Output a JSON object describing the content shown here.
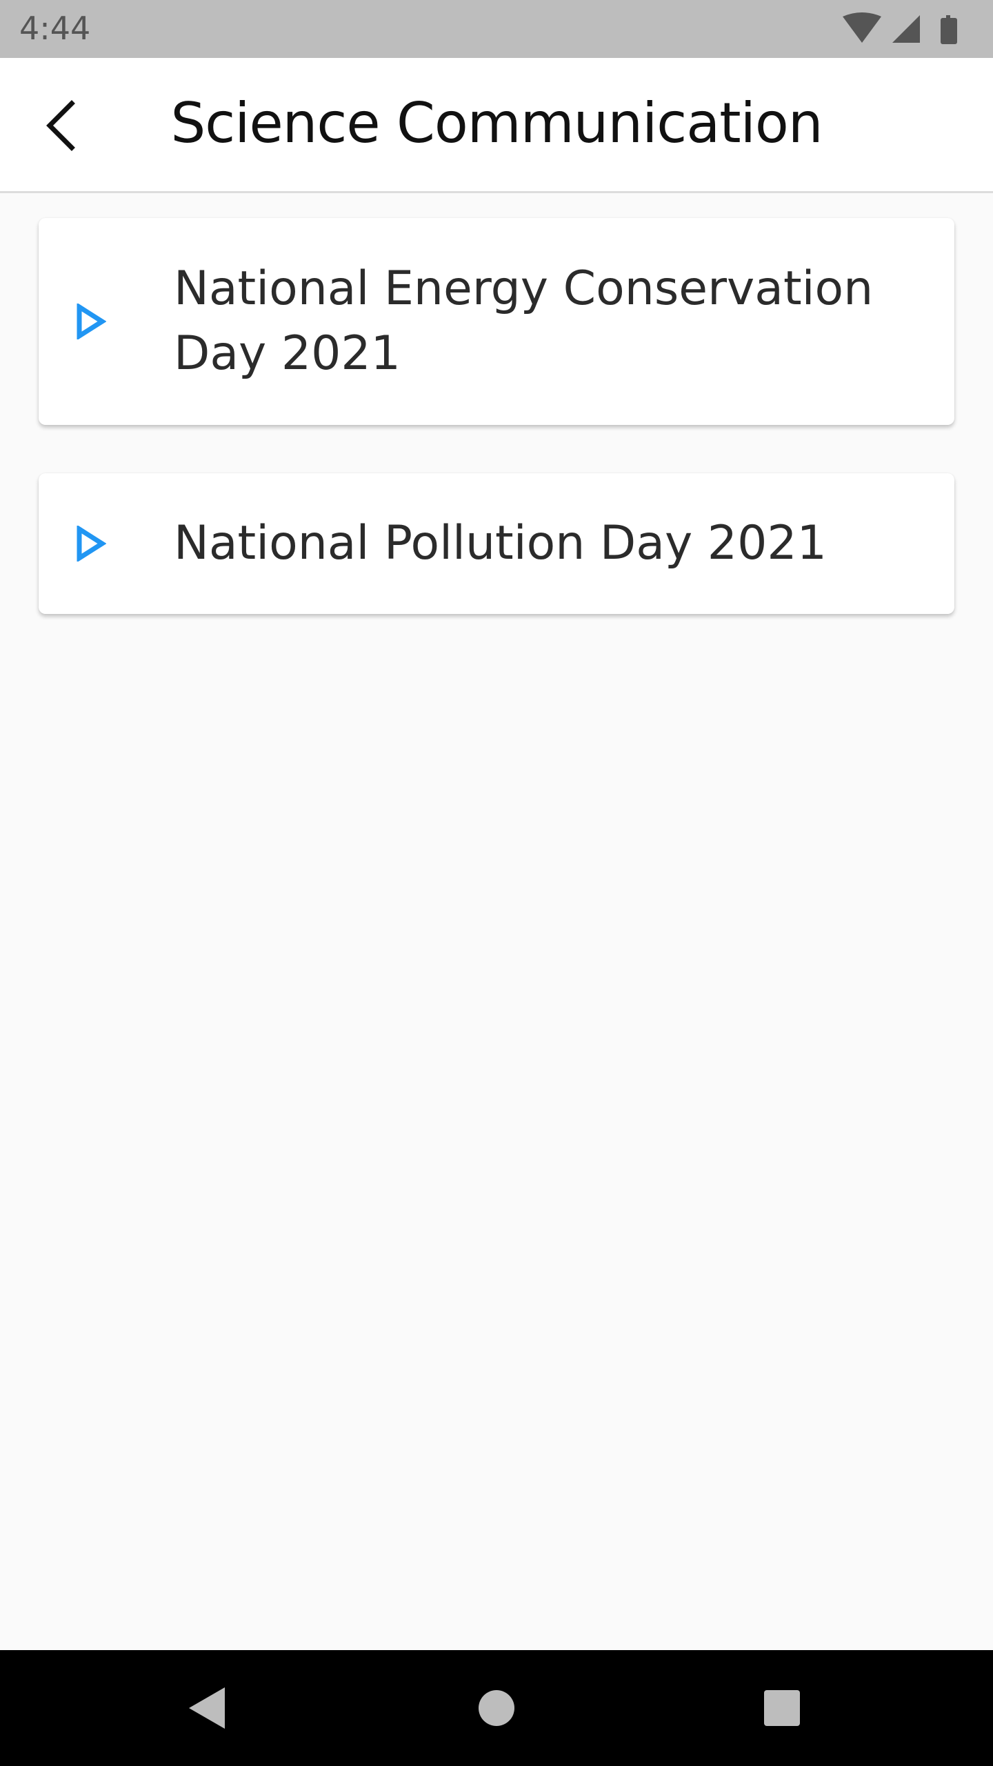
{
  "status_bar": {
    "time": "4:44",
    "icons": [
      "wifi-icon",
      "cellular-signal-icon",
      "battery-icon"
    ]
  },
  "app_bar": {
    "back_icon": "chevron-left-icon",
    "title": "Science Communication"
  },
  "list": {
    "items": [
      {
        "label": "National Energy Conservation Day 2021",
        "icon": "play-triangle-icon"
      },
      {
        "label": "National Pollution Day 2021",
        "icon": "play-triangle-icon"
      }
    ]
  },
  "nav_bar": {
    "buttons": [
      "back-triangle-icon",
      "home-circle-icon",
      "recents-square-icon"
    ]
  },
  "colors": {
    "accent": "#2196f3",
    "status_bar": "#bdbdbd",
    "background": "#fafafa",
    "nav_bar": "#000000"
  }
}
